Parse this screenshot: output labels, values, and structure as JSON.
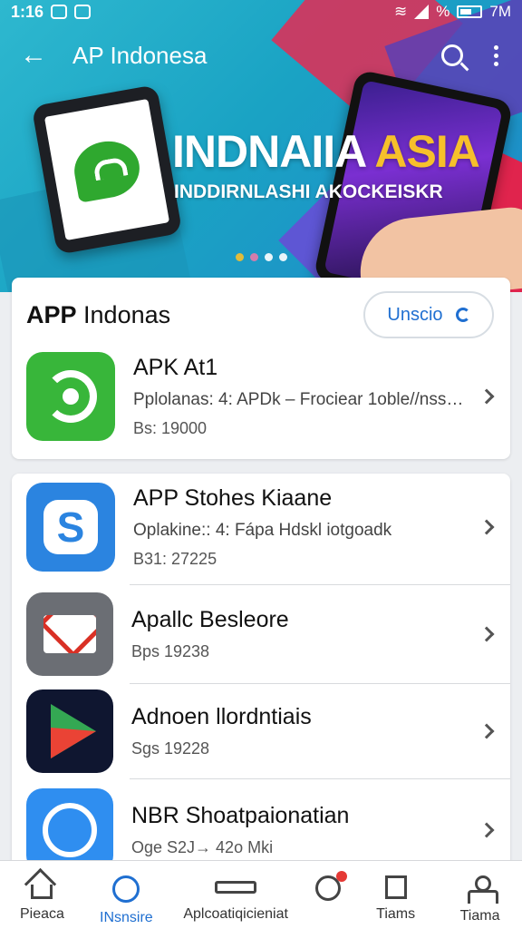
{
  "status_bar": {
    "time": "1:16",
    "right_text": "% ",
    "battery_text": "7M"
  },
  "app_bar": {
    "back_icon": "arrow-left-icon",
    "title": "AP Indonesa",
    "search_icon": "search-icon",
    "more_icon": "more-vert-icon"
  },
  "banner": {
    "headline_main": "INDNAIIA ",
    "headline_accent": "ASIA",
    "subline": "INDDIRNLASHI AKOCKEISKR",
    "accent_color": "#f6c02b",
    "pager_dots": 4
  },
  "featured_card": {
    "title_bold": "APP",
    "title_rest": " Indonas",
    "action_label": "Unscio",
    "app": {
      "name": "APK At1",
      "description": "Pplolanas: 4: APDk – Frociear 1oble//nssn...",
      "meta": "Bs: 19000",
      "icon": "green-sync-icon"
    }
  },
  "app_list": [
    {
      "name": "APP Stohes Kiaane",
      "description": "Oplakine:: 4: Fápa Hdskl iotgoadk",
      "meta": "B31: 27225",
      "icon": "blue-s-icon"
    },
    {
      "name": "Apallc Besleore",
      "description": "",
      "meta": "Bps 19238",
      "icon": "mail-icon"
    },
    {
      "name": "Adnoen llordntiais",
      "description": "",
      "meta": "Sgs 19228",
      "icon": "play-icon"
    },
    {
      "name": "NBR Shoatpaionatian",
      "description": "",
      "meta": "Oge S2J→ 42o Mki",
      "icon": "chat-icon"
    }
  ],
  "bottom_nav": [
    {
      "label": "Pieaca",
      "icon": "home-icon",
      "active": false
    },
    {
      "label": "INsnsire",
      "icon": "explore-icon",
      "active": true
    },
    {
      "label": "Aplcoatiqicieniat",
      "icon": "apps-icon",
      "active": false
    },
    {
      "label": "",
      "icon": "notifications-icon",
      "active": false
    },
    {
      "label": "Tiams",
      "icon": "theme-icon",
      "active": false
    },
    {
      "label": "Tiama",
      "icon": "profile-icon",
      "active": false
    }
  ],
  "colors": {
    "primary": "#1f6fd1",
    "banner_blue": "#1aa3c4",
    "banner_red": "#e0244d",
    "banner_purple": "#5a3fb5"
  }
}
